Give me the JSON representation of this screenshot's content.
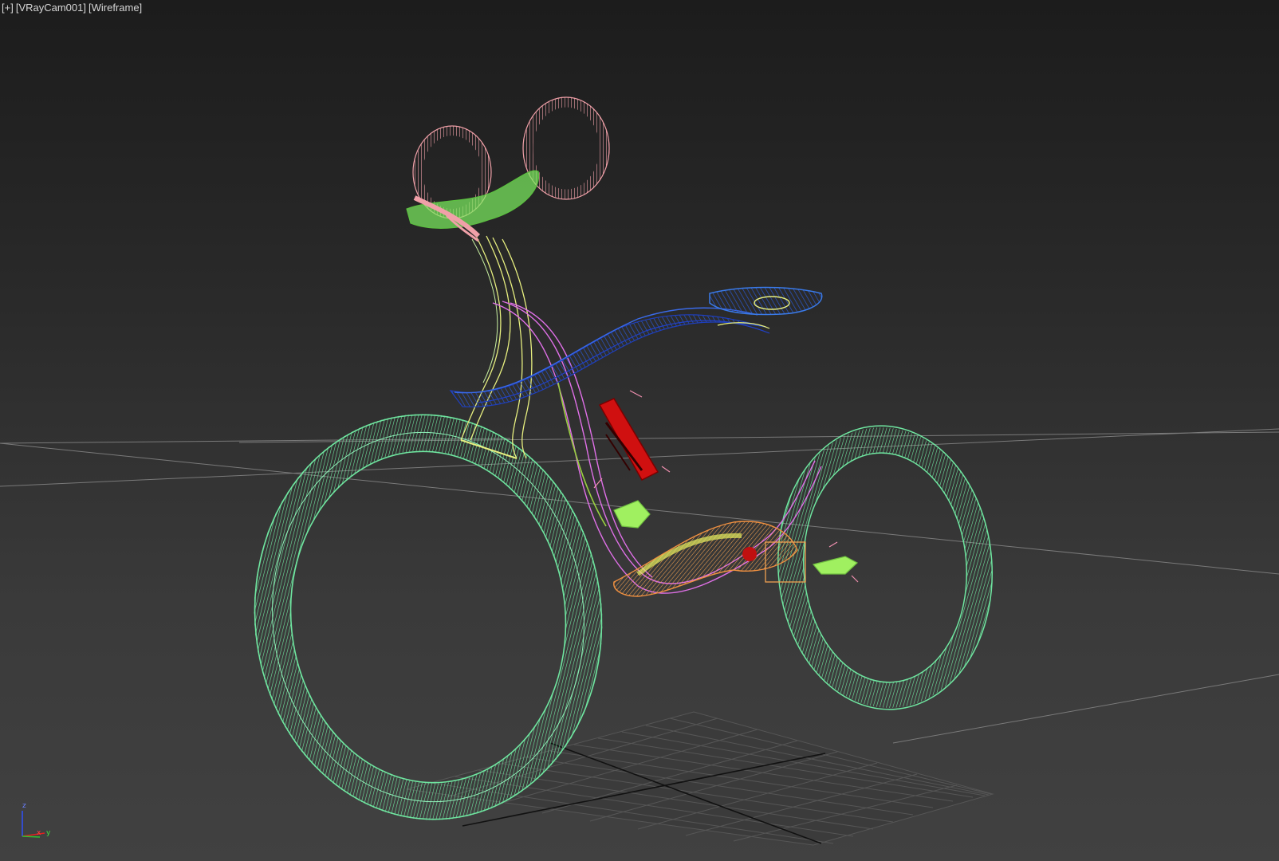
{
  "viewport": {
    "label": {
      "maximize_toggle": "[+]",
      "camera": "[VRayCam001]",
      "shading": "[Wireframe]"
    },
    "axis_gizmo": {
      "z_label": "z",
      "x_label": "x",
      "y_label": "y"
    }
  },
  "colors": {
    "background_top": "#1c1c1c",
    "background_bottom": "#414141",
    "wheels": "#6fe6a0",
    "handlebar_grips": "#f0a0a8",
    "handlebar_clamp": "#7cf060",
    "fork": "#e8f080",
    "frame": "#e070e8",
    "seat_beam": "#2050d8",
    "seat": "#3a7ae8",
    "battery": "#d01010",
    "crank": "#f09040",
    "pedal": "#a0f060"
  }
}
